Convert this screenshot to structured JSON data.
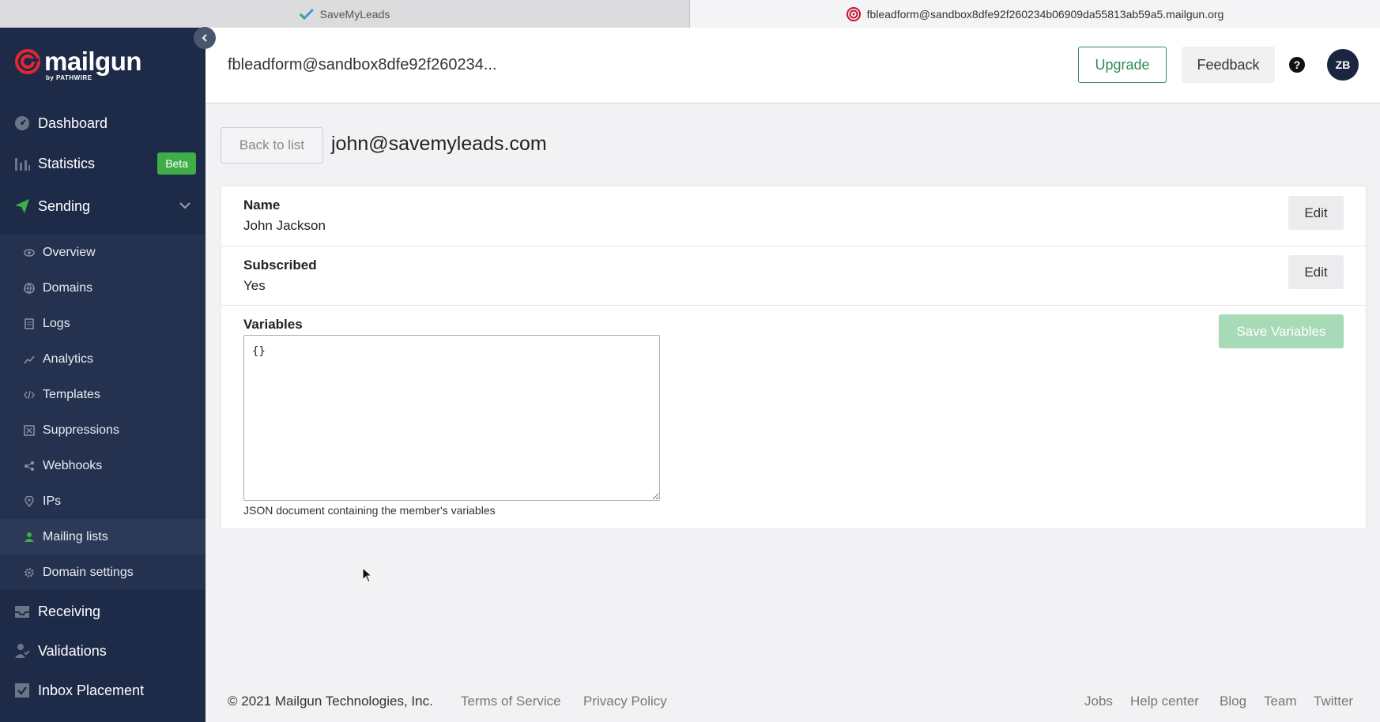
{
  "browser": {
    "tabs": [
      {
        "title": "SaveMyLeads",
        "active": false
      },
      {
        "title": "fbleadform@sandbox8dfe92f260234b06909da55813ab59a5.mailgun.org",
        "active": true
      }
    ]
  },
  "sidebar": {
    "logo": "mailgun",
    "logo_sub": "by PATHWIRE",
    "collapse_icon": "chevron-left-icon",
    "main_items": [
      {
        "label": "Dashboard",
        "icon": "dashboard-icon"
      },
      {
        "label": "Statistics",
        "icon": "bar-chart-icon",
        "badge": "Beta"
      },
      {
        "label": "Sending",
        "icon": "paper-plane-icon",
        "expanded": true
      },
      {
        "label": "Receiving",
        "icon": "inbox-icon"
      },
      {
        "label": "Validations",
        "icon": "user-check-icon"
      },
      {
        "label": "Inbox Placement",
        "icon": "checkbox-icon"
      }
    ],
    "sub_items": [
      {
        "label": "Overview",
        "icon": "eye-icon"
      },
      {
        "label": "Domains",
        "icon": "globe-icon"
      },
      {
        "label": "Logs",
        "icon": "document-icon"
      },
      {
        "label": "Analytics",
        "icon": "trend-icon"
      },
      {
        "label": "Templates",
        "icon": "code-icon"
      },
      {
        "label": "Suppressions",
        "icon": "x-box-icon"
      },
      {
        "label": "Webhooks",
        "icon": "share-icon"
      },
      {
        "label": "IPs",
        "icon": "location-pin-icon"
      },
      {
        "label": "Mailing lists",
        "icon": "person-icon",
        "active": true
      },
      {
        "label": "Domain settings",
        "icon": "gear-icon"
      }
    ]
  },
  "header": {
    "title": "fbleadform@sandbox8dfe92f260234...",
    "upgrade_label": "Upgrade",
    "feedback_label": "Feedback",
    "help_glyph": "?",
    "avatar_initials": "ZB"
  },
  "main": {
    "back_label": "Back to list",
    "member_email": "john@savemyleads.com",
    "fields": {
      "name_label": "Name",
      "name_value": "John Jackson",
      "subscribed_label": "Subscribed",
      "subscribed_value": "Yes",
      "edit_label": "Edit",
      "variables_label": "Variables",
      "variables_value": "{}",
      "variables_help": "JSON document containing the member's variables",
      "save_label": "Save Variables"
    }
  },
  "footer": {
    "copyright": "© 2021 Mailgun Technologies, Inc.",
    "terms": "Terms of Service",
    "privacy": "Privacy Policy",
    "jobs": "Jobs",
    "help_center": "Help center",
    "blog": "Blog",
    "team": "Team",
    "twitter": "Twitter"
  },
  "colors": {
    "sidebar_bg": "#1e2b48",
    "accent_green": "#2e8a55",
    "beta_green": "#3fae49",
    "brand_red": "#e4262f"
  }
}
